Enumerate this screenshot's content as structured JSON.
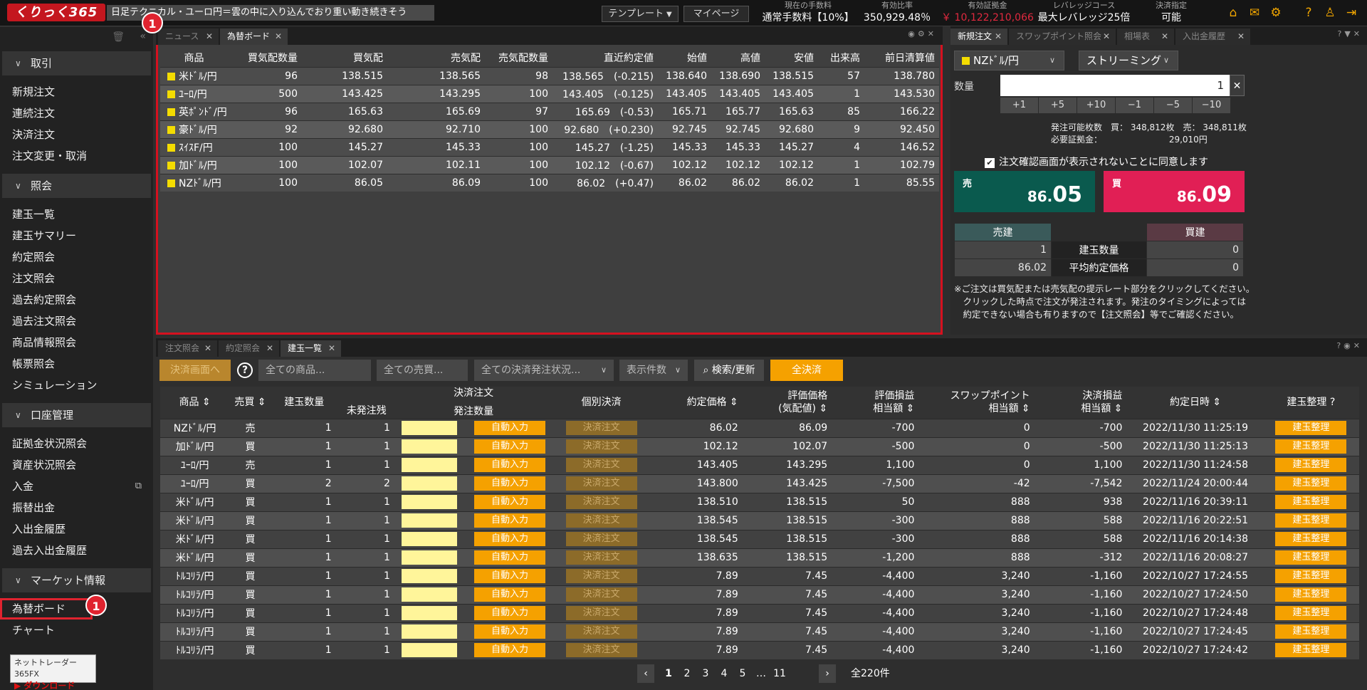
{
  "header": {
    "logo": "くりっく365",
    "news": "日足テクニカル・ユーロ円＝雲の中に入り込んでおり重い動き続きそう",
    "template": "テンプレート",
    "mypage": "マイページ",
    "stats": [
      {
        "label": "現在の手数料",
        "value": "通常手数料【10%】"
      },
      {
        "label": "有効比率",
        "value": "350,929.48％"
      },
      {
        "label": "有効証拠金",
        "value": "￥ 10,122,210,066"
      },
      {
        "label": "レバレッジコース",
        "value": "最大レバレッジ25倍"
      },
      {
        "label": "決済指定",
        "value": "可能"
      }
    ]
  },
  "sidebar": {
    "sections": [
      {
        "title": "取引",
        "items": [
          "新規注文",
          "連続注文",
          "決済注文",
          "注文変更・取消"
        ]
      },
      {
        "title": "照会",
        "items": [
          "建玉一覧",
          "建玉サマリー",
          "約定照会",
          "注文照会",
          "過去約定照会",
          "過去注文照会",
          "商品情報照会",
          "帳票照会",
          "シミュレーション"
        ]
      },
      {
        "title": "口座管理",
        "items": [
          "証拠金状況照会",
          "資産状況照会",
          "入金",
          "振替出金",
          "入出金履歴",
          "過去入出金履歴"
        ]
      },
      {
        "title": "マーケット情報",
        "items": [
          "為替ボード",
          "チャート"
        ]
      }
    ],
    "download_line1": "ネットトレーダー365FX",
    "download_line2": "ダウンロード",
    "badge": "1"
  },
  "fx_board": {
    "tabs": [
      "ニュース",
      "為替ボード"
    ],
    "columns": [
      "商品",
      "買気配数量",
      "買気配",
      "売気配",
      "売気配数量",
      "直近約定値",
      "始値",
      "高値",
      "安値",
      "出来高",
      "前日清算値"
    ],
    "rows": [
      [
        "米ﾄﾞﾙ/円",
        "96",
        "138.515",
        "138.565",
        "98",
        "138.565　(-0.215)",
        "138.640",
        "138.690",
        "138.515",
        "57",
        "138.780"
      ],
      [
        "ﾕｰﾛ/円",
        "500",
        "143.425",
        "143.295",
        "100",
        "143.405　(-0.125)",
        "143.405",
        "143.405",
        "143.405",
        "1",
        "143.530"
      ],
      [
        "英ﾎﾟﾝﾄﾞ/円",
        "96",
        "165.63",
        "165.69",
        "97",
        "165.69　(-0.53)",
        "165.71",
        "165.77",
        "165.63",
        "85",
        "166.22"
      ],
      [
        "豪ﾄﾞﾙ/円",
        "92",
        "92.680",
        "92.710",
        "100",
        "92.680　(+0.230)",
        "92.745",
        "92.745",
        "92.680",
        "9",
        "92.450"
      ],
      [
        "ｽｲｽF/円",
        "100",
        "145.27",
        "145.33",
        "100",
        "145.27　(-1.25)",
        "145.33",
        "145.33",
        "145.27",
        "4",
        "146.52"
      ],
      [
        "加ﾄﾞﾙ/円",
        "100",
        "102.07",
        "102.11",
        "100",
        "102.12　(-0.67)",
        "102.12",
        "102.12",
        "102.12",
        "1",
        "102.79"
      ],
      [
        "NZﾄﾞﾙ/円",
        "100",
        "86.05",
        "86.09",
        "100",
        "86.02　(+0.47)",
        "86.02",
        "86.02",
        "86.02",
        "1",
        "85.55"
      ]
    ]
  },
  "order": {
    "tabs": [
      "新規注文",
      "スワップポイント照会",
      "相場表",
      "入出金履歴"
    ],
    "pair": "NZﾄﾞﾙ/円",
    "mode": "ストリーミング",
    "qty_label": "数量",
    "qty": "1",
    "steps": [
      "+1",
      "+5",
      "+10",
      "−1",
      "−5",
      "−10"
    ],
    "avail": "発注可能枚数　買： 348,812枚　売： 348,811枚",
    "margin": "必要証拠金：　　　　　　　　 29,010円",
    "confirm": "注文確認画面が表示されないことに同意します",
    "sell_label": "売",
    "sell_small": "86.",
    "sell_big": "05",
    "buy_label": "買",
    "buy_small": "86.",
    "buy_big": "09",
    "pos_sell": "売建",
    "pos_buy": "買建",
    "pos_qty_label": "建玉数量",
    "pos_avg_label": "平均約定価格",
    "sell_qty": "1",
    "buy_qty": "0",
    "sell_avg": "86.02",
    "buy_avg": "0",
    "note": "※ご注文は買気配または売気配の提示レート部分をクリックしてください。\n　クリックした時点で注文が発注されます。発注のタイミングによっては\n　約定できない場合も有りますので【注文照会】等でご確認ください。"
  },
  "positions": {
    "tabs": [
      "注文照会",
      "約定照会",
      "建玉一覧"
    ],
    "settle_screen": "決済画面へ",
    "help": "?",
    "filters": [
      "全ての商品...",
      "全ての売買...",
      "全ての決済発注状況...",
      "表示件数"
    ],
    "search": "検索/更新",
    "settle_all": "全決済",
    "head": {
      "pair": "商品",
      "side": "売買",
      "qty": "建玉数量",
      "unsettled": "未発注残",
      "order": "決済注文",
      "order_qty": "発注数量",
      "indiv": "個別決済",
      "price": "約定価格",
      "eval": "評価価格",
      "eval2": "(気配値)",
      "pl": "評価損益",
      "pl2": "相当額",
      "swap": "スワップポイント",
      "swap2": "相当額",
      "spl": "決済損益",
      "spl2": "相当額",
      "date": "約定日時",
      "arrange": "建玉整理"
    },
    "auto": "自動入力",
    "settle_order": "決済注文",
    "arrange": "建玉整理",
    "rows": [
      [
        "NZﾄﾞﾙ/円",
        "売",
        "1",
        "1",
        "86.02",
        "86.09",
        "-700",
        "0",
        "-700",
        "2022/11/30 11:25:19"
      ],
      [
        "加ﾄﾞﾙ/円",
        "買",
        "1",
        "1",
        "102.12",
        "102.07",
        "-500",
        "0",
        "-500",
        "2022/11/30 11:25:13"
      ],
      [
        "ﾕｰﾛ/円",
        "売",
        "1",
        "1",
        "143.405",
        "143.295",
        "1,100",
        "0",
        "1,100",
        "2022/11/30 11:24:58"
      ],
      [
        "ﾕｰﾛ/円",
        "買",
        "2",
        "2",
        "143.800",
        "143.425",
        "-7,500",
        "-42",
        "-7,542",
        "2022/11/24 20:00:44"
      ],
      [
        "米ﾄﾞﾙ/円",
        "買",
        "1",
        "1",
        "138.510",
        "138.515",
        "50",
        "888",
        "938",
        "2022/11/16 20:39:11"
      ],
      [
        "米ﾄﾞﾙ/円",
        "買",
        "1",
        "1",
        "138.545",
        "138.515",
        "-300",
        "888",
        "588",
        "2022/11/16 20:22:51"
      ],
      [
        "米ﾄﾞﾙ/円",
        "買",
        "1",
        "1",
        "138.545",
        "138.515",
        "-300",
        "888",
        "588",
        "2022/11/16 20:14:38"
      ],
      [
        "米ﾄﾞﾙ/円",
        "買",
        "1",
        "1",
        "138.635",
        "138.515",
        "-1,200",
        "888",
        "-312",
        "2022/11/16 20:08:27"
      ],
      [
        "ﾄﾙｺﾘﾗ/円",
        "買",
        "1",
        "1",
        "7.89",
        "7.45",
        "-4,400",
        "3,240",
        "-1,160",
        "2022/10/27 17:24:55"
      ],
      [
        "ﾄﾙｺﾘﾗ/円",
        "買",
        "1",
        "1",
        "7.89",
        "7.45",
        "-4,400",
        "3,240",
        "-1,160",
        "2022/10/27 17:24:50"
      ],
      [
        "ﾄﾙｺﾘﾗ/円",
        "買",
        "1",
        "1",
        "7.89",
        "7.45",
        "-4,400",
        "3,240",
        "-1,160",
        "2022/10/27 17:24:48"
      ],
      [
        "ﾄﾙｺﾘﾗ/円",
        "買",
        "1",
        "1",
        "7.89",
        "7.45",
        "-4,400",
        "3,240",
        "-1,160",
        "2022/10/27 17:24:45"
      ],
      [
        "ﾄﾙｺﾘﾗ/円",
        "買",
        "1",
        "1",
        "7.89",
        "7.45",
        "-4,400",
        "3,240",
        "-1,160",
        "2022/10/27 17:24:42"
      ]
    ],
    "pages": [
      "1",
      "2",
      "3",
      "4",
      "5",
      "…",
      "11"
    ],
    "total": "全220件"
  },
  "colors": {
    "accent": "#f5a100",
    "sell": "#0a5a4e",
    "buy": "#e11f55",
    "highlight": "#d6111f"
  }
}
